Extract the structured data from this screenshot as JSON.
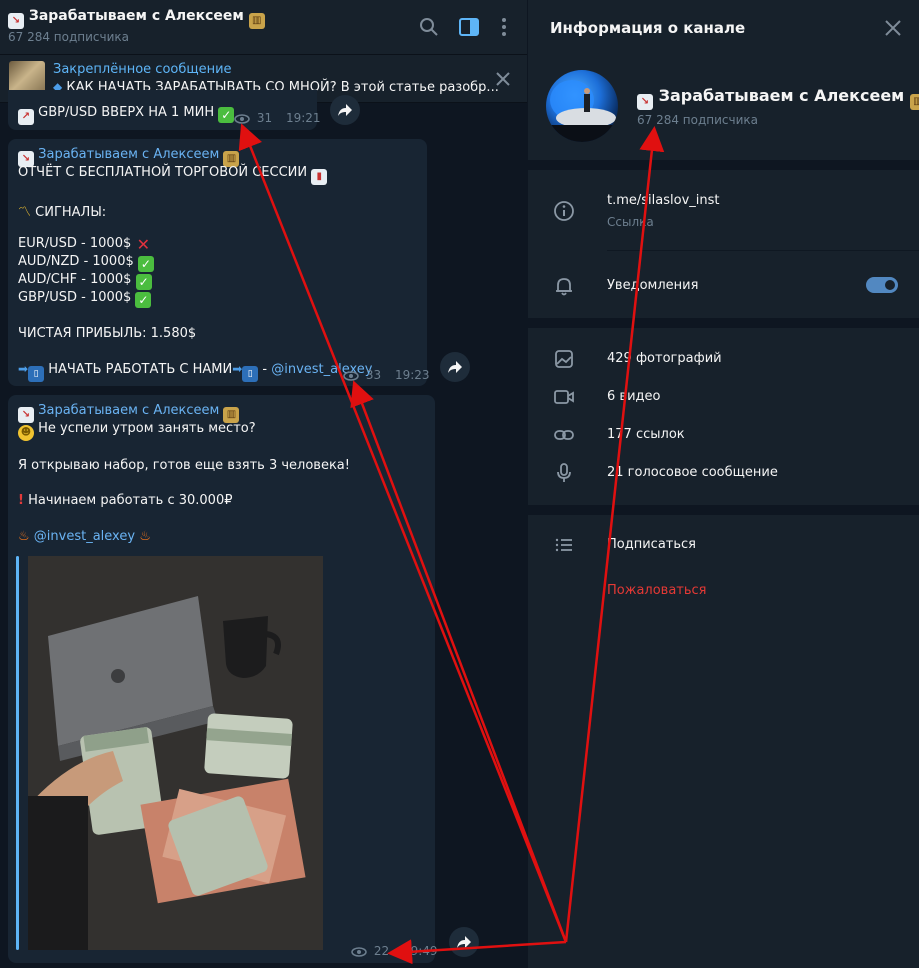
{
  "chat_header": {
    "title": "Зарабатываем с Алексеем",
    "subtitle": "67 284 подписчика"
  },
  "pinned": {
    "title": "Закреплённое сообщение",
    "text": "КАК НАЧАТЬ ЗАРАБАТЫВАТЬ СО МНОЙ?  В этой статье разобр..."
  },
  "messages": [
    {
      "text": "GBP/USD ВВЕРХ НА 1 МИН",
      "views": "31",
      "time": "19:21"
    },
    {
      "sender": "Зарабатываем с Алексеем",
      "lines": [
        "ОТЧЁТ С БЕСПЛАТНОЙ ТОРГОВОЙ СЕССИИ",
        "СИГНАЛЫ:",
        "EUR/USD - 1000$",
        "AUD/NZD - 1000$",
        "AUD/CHF - 1000$",
        "GBP/USD - 1000$",
        "ЧИСТАЯ ПРИБЫЛЬ: 1.580$",
        "НАЧАТЬ РАБОТАТЬ С НАМИ",
        " - ",
        "@invest_alexey"
      ],
      "views": "33",
      "time": "19:23"
    },
    {
      "sender": "Зарабатываем с Алексеем",
      "lines": [
        "Не успели утром занять место?",
        "Я открываю набор, готов еще взять 3 человека!",
        "Начинаем работать с 30.000₽",
        "@invest_alexey"
      ],
      "views": "22",
      "time": "19:49"
    }
  ],
  "panel": {
    "title": "Информация о канале",
    "channel_name": "Зарабатываем с Алексеем",
    "subscribers": "67 284 подписчика",
    "link": "t.me/silaslov_inst",
    "link_label": "Ссылка",
    "notifications": "Уведомления",
    "notifications_on": true,
    "media": [
      {
        "label": "429 фотографий",
        "icon": "photo-icon"
      },
      {
        "label": "6 видео",
        "icon": "video-icon"
      },
      {
        "label": "177 ссылок",
        "icon": "link-icon"
      },
      {
        "label": "21 голосовое сообщение",
        "icon": "mic-icon"
      }
    ],
    "subscribe": "Подписаться",
    "report": "Пожаловаться"
  },
  "colors": {
    "background": "#0e1621",
    "panel": "#17212b",
    "bubble": "#182533",
    "accent": "#6ab3f3",
    "toggle": "#5288c1",
    "danger": "#e53935",
    "annotation": "#e01010"
  }
}
